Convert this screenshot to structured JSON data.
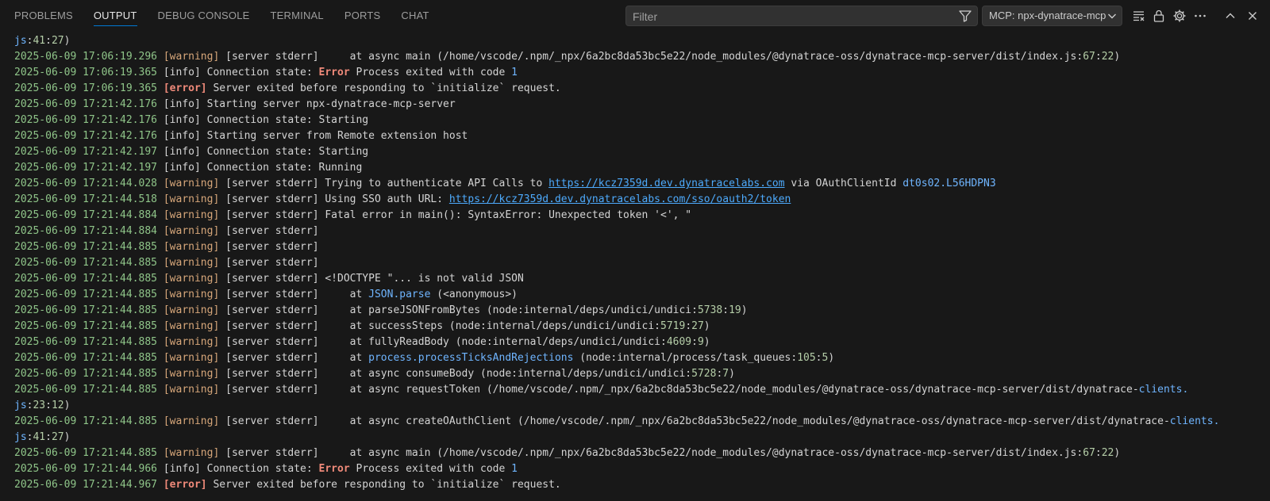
{
  "tabs": [
    "PROBLEMS",
    "OUTPUT",
    "DEBUG CONSOLE",
    "TERMINAL",
    "PORTS",
    "CHAT"
  ],
  "active_tab": "OUTPUT",
  "filter": {
    "placeholder": "Filter",
    "value": ""
  },
  "channel": {
    "label": "MCP: npx-dynatrace-mcp-server"
  },
  "toolbar_icons": [
    "clear-output-icon",
    "lock-scroll-icon",
    "settings-gear-icon",
    "more-actions-icon",
    "maximize-panel-icon",
    "close-panel-icon"
  ],
  "colors": {
    "timestamp": "#8fc589",
    "warning": "#d7a77a",
    "error": "#f08a7a",
    "link": "#4daafc",
    "accent": "#0078d4"
  },
  "log_lines": [
    "js:41:27)",
    "2025-06-09 17:06:19.296 [warning] [server stderr]     at async main (/home/vscode/.npm/_npx/6a2bc8da53bc5e22/node_modules/@dynatrace-oss/dynatrace-mcp-server/dist/index.js:67:22)",
    "2025-06-09 17:06:19.365 [info] Connection state: Error Process exited with code 1",
    "2025-06-09 17:06:19.365 [error] Server exited before responding to `initialize` request.",
    "2025-06-09 17:21:42.176 [info] Starting server npx-dynatrace-mcp-server",
    "2025-06-09 17:21:42.176 [info] Connection state: Starting",
    "2025-06-09 17:21:42.176 [info] Starting server from Remote extension host",
    "2025-06-09 17:21:42.197 [info] Connection state: Starting",
    "2025-06-09 17:21:42.197 [info] Connection state: Running",
    "2025-06-09 17:21:44.028 [warning] [server stderr] Trying to authenticate API Calls to https://kcz7359d.dev.dynatracelabs.com via OAuthClientId dt0s02.L56HDPN3",
    "2025-06-09 17:21:44.518 [warning] [server stderr] Using SSO auth URL: https://kcz7359d.dev.dynatracelabs.com/sso/oauth2/token",
    "2025-06-09 17:21:44.884 [warning] [server stderr] Fatal error in main(): SyntaxError: Unexpected token '<', \"",
    "2025-06-09 17:21:44.884 [warning] [server stderr] ",
    "2025-06-09 17:21:44.885 [warning] [server stderr] ",
    "2025-06-09 17:21:44.885 [warning] [server stderr] ",
    "2025-06-09 17:21:44.885 [warning] [server stderr] <!DOCTYPE \"... is not valid JSON",
    "2025-06-09 17:21:44.885 [warning] [server stderr]     at JSON.parse (<anonymous>)",
    "2025-06-09 17:21:44.885 [warning] [server stderr]     at parseJSONFromBytes (node:internal/deps/undici/undici:5738:19)",
    "2025-06-09 17:21:44.885 [warning] [server stderr]     at successSteps (node:internal/deps/undici/undici:5719:27)",
    "2025-06-09 17:21:44.885 [warning] [server stderr]     at fullyReadBody (node:internal/deps/undici/undici:4609:9)",
    "2025-06-09 17:21:44.885 [warning] [server stderr]     at process.processTicksAndRejections (node:internal/process/task_queues:105:5)",
    "2025-06-09 17:21:44.885 [warning] [server stderr]     at async consumeBody (node:internal/deps/undici/undici:5728:7)",
    "2025-06-09 17:21:44.885 [warning] [server stderr]     at async requestToken (/home/vscode/.npm/_npx/6a2bc8da53bc5e22/node_modules/@dynatrace-oss/dynatrace-mcp-server/dist/dynatrace-clients.",
    "js:23:12)",
    "2025-06-09 17:21:44.885 [warning] [server stderr]     at async createOAuthClient (/home/vscode/.npm/_npx/6a2bc8da53bc5e22/node_modules/@dynatrace-oss/dynatrace-mcp-server/dist/dynatrace-clients.",
    "js:41:27)",
    "2025-06-09 17:21:44.885 [warning] [server stderr]     at async main (/home/vscode/.npm/_npx/6a2bc8da53bc5e22/node_modules/@dynatrace-oss/dynatrace-mcp-server/dist/index.js:67:22)",
    "2025-06-09 17:21:44.966 [info] Connection state: Error Process exited with code 1",
    "2025-06-09 17:21:44.967 [error] Server exited before responding to `initialize` request."
  ]
}
